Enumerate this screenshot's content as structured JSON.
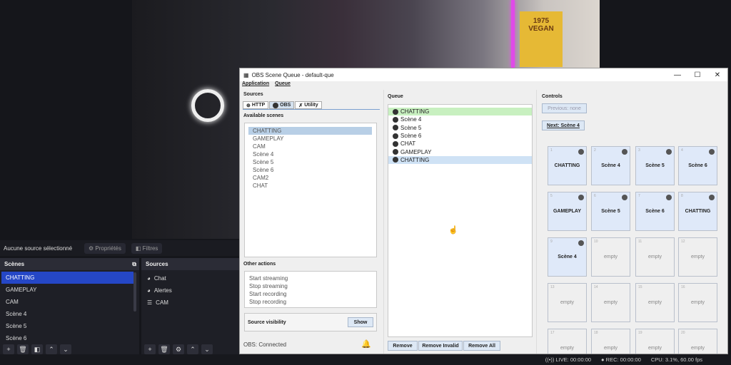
{
  "webcam": {
    "poster_text": "1975 VEGAN"
  },
  "obs": {
    "status_text": "Aucune source sélectionné",
    "properties_label": "Propriétés",
    "filters_label": "Filtres",
    "scenes_title": "Scènes",
    "sources_title": "Sources",
    "scenes": [
      "CHATTING",
      "GAMEPLAY",
      "CAM",
      "Scène 4",
      "Scène 5",
      "Scène 6"
    ],
    "selected_scene": "CHATTING",
    "sources": [
      {
        "name": "Chat",
        "icon": "browser-icon"
      },
      {
        "name": "Alertes",
        "icon": "browser-icon"
      },
      {
        "name": "CAM",
        "icon": "list-icon"
      }
    ],
    "statusbar": {
      "live": "LIVE: 00:00:00",
      "rec": "REC: 00:00:00",
      "cpu": "CPU: 3.1%, 60.00 fps"
    }
  },
  "window": {
    "title": "OBS Scene Queue - default-que",
    "menu": [
      "Application",
      "Queue"
    ],
    "sources_label": "Sources",
    "tabs": [
      "HTTP",
      "OBS",
      "Utility"
    ],
    "active_tab": "OBS",
    "available_scenes_label": "Available scenes",
    "available_scenes": [
      "CHATTING",
      "GAMEPLAY",
      "CAM",
      "Scène 4",
      "Scène 5",
      "Scène 6",
      "CAM2",
      "CHAT"
    ],
    "other_actions_label": "Other actions",
    "other_actions": [
      "Start streaming",
      "Stop streaming",
      "Start recording",
      "Stop recording"
    ],
    "source_visibility_label": "Source visibility",
    "show_label": "Show",
    "connection_status": "OBS: Connected",
    "queue_label": "Queue",
    "queue": [
      "CHATTING",
      "Scène 4",
      "Scène 5",
      "Scène 6",
      "CHAT",
      "GAMEPLAY",
      "CHATTING"
    ],
    "queue_remove": "Remove",
    "queue_remove_invalid": "Remove Invalid",
    "queue_remove_all": "Remove All",
    "controls_label": "Controls",
    "previous_label": "Previous: none",
    "next_label": "Next: Scène 4",
    "tiles": [
      {
        "n": "1",
        "label": "CHATTING"
      },
      {
        "n": "2",
        "label": "Scène 4"
      },
      {
        "n": "3",
        "label": "Scène 5"
      },
      {
        "n": "4",
        "label": "Scène 6"
      },
      {
        "n": "5",
        "label": "GAMEPLAY"
      },
      {
        "n": "6",
        "label": "Scène 5"
      },
      {
        "n": "7",
        "label": "Scène 6"
      },
      {
        "n": "8",
        "label": "CHATTING"
      },
      {
        "n": "9",
        "label": "Scène 4"
      },
      {
        "n": "10",
        "label": "empty"
      },
      {
        "n": "11",
        "label": "empty"
      },
      {
        "n": "12",
        "label": "empty"
      },
      {
        "n": "13",
        "label": "empty"
      },
      {
        "n": "14",
        "label": "empty"
      },
      {
        "n": "15",
        "label": "empty"
      },
      {
        "n": "16",
        "label": "empty"
      },
      {
        "n": "17",
        "label": "empty"
      },
      {
        "n": "18",
        "label": "empty"
      },
      {
        "n": "19",
        "label": "empty"
      },
      {
        "n": "20",
        "label": "empty"
      }
    ],
    "colors": {
      "queue_current": "#c8f0c0",
      "queue_selected": "#cfe2f5",
      "tile_filled": "#dfe9f9"
    }
  }
}
